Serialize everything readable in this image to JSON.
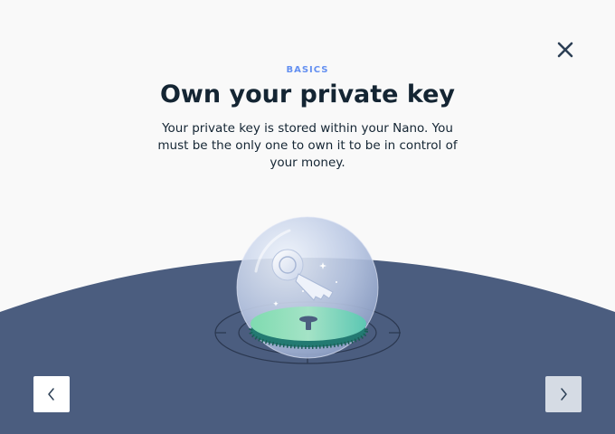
{
  "header": {
    "kicker": "BASICS",
    "title": "Own your private key",
    "description": "Your private key is stored within your Nano. You must be the only one to own it to be in control of your money."
  },
  "icons": {
    "close": "close-icon",
    "previous": "chevron-left-icon",
    "next": "chevron-right-icon",
    "illustration": "key-in-glass-dome-illustration"
  },
  "colors": {
    "background": "#f9f9f9",
    "ground": "#4b5d7f",
    "accent": "#6490f1",
    "title": "#142533"
  }
}
